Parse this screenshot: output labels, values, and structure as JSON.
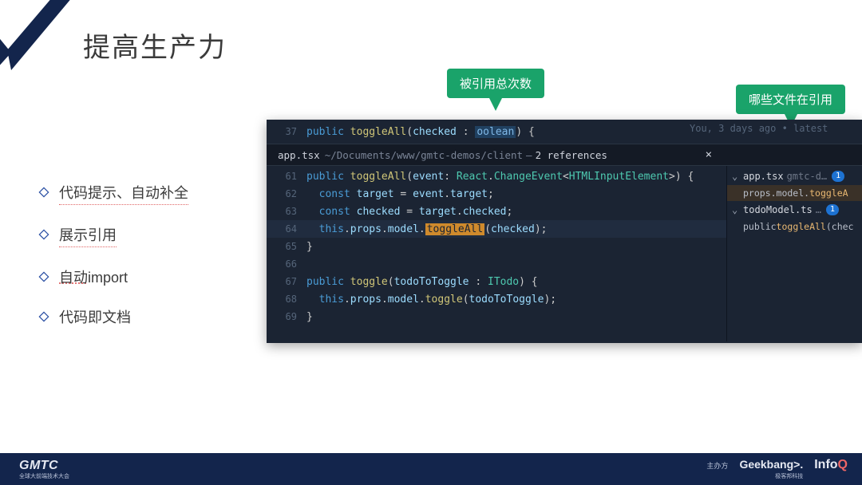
{
  "title": "提高生产力",
  "bullets": [
    {
      "text": "代码提示、自动补全",
      "underline": true
    },
    {
      "text": "展示引用",
      "underline": true
    },
    {
      "text": "自动import",
      "underline": false,
      "decorated_segment": "自动"
    },
    {
      "text": "代码即文档",
      "underline": false
    }
  ],
  "callouts": {
    "total_refs": "被引用总次数",
    "files_refs": "哪些文件在引用"
  },
  "editor": {
    "top_line_no": "37",
    "blame": "You, 3 days ago • latest",
    "refs_bar": {
      "filename": "app.tsx",
      "path": "~/Documents/www/gmtc-demos/client",
      "refs": "2 references",
      "close": "×"
    },
    "code_lines": [
      {
        "no": "61"
      },
      {
        "no": "62"
      },
      {
        "no": "63"
      },
      {
        "no": "64",
        "highlight": true
      },
      {
        "no": "65"
      },
      {
        "no": "66"
      },
      {
        "no": "67"
      },
      {
        "no": "68"
      },
      {
        "no": "69"
      }
    ],
    "top_signature": {
      "kw": "public",
      "fn": "toggleAll",
      "param": "checked",
      "type_ghost": "oolean",
      "brace": "{"
    },
    "tokens": {
      "kw_public": "public",
      "kw_const": "const",
      "kw_this": "this",
      "fn_toggleAll": "toggleAll",
      "fn_toggle": "toggle",
      "var_event": "event",
      "var_target": "target",
      "var_checked": "checked",
      "var_todoToToggle": "todoToToggle",
      "ns_React": "React",
      "type_ChangeEvent": "ChangeEvent",
      "type_HTMLInputElement": "HTMLInputElement",
      "type_ITodo": "ITodo",
      "prop_props": "props",
      "prop_model": "model",
      "high_toggleAll": "toggleAll"
    },
    "sidebar": {
      "items": [
        {
          "file": "app.tsx",
          "dim": "gmtc-d…",
          "badge": "1",
          "sub": "props.model.toggleA",
          "sub_highlight": "toggleA",
          "selected": true
        },
        {
          "file": "todoModel.ts",
          "dim": "…",
          "badge": "1",
          "sub": "public toggleAll(chec",
          "sub_highlight": "toggleAll",
          "selected": false
        }
      ]
    }
  },
  "footer": {
    "brand": "GMTC",
    "brand_sub": "全球大前端技术大会",
    "host_label": "主办方",
    "geekbang": "Geekbang",
    "geekbang_chev": ">.",
    "geekbang_sub": "极客邦科技",
    "infoq": "InfoQ"
  }
}
